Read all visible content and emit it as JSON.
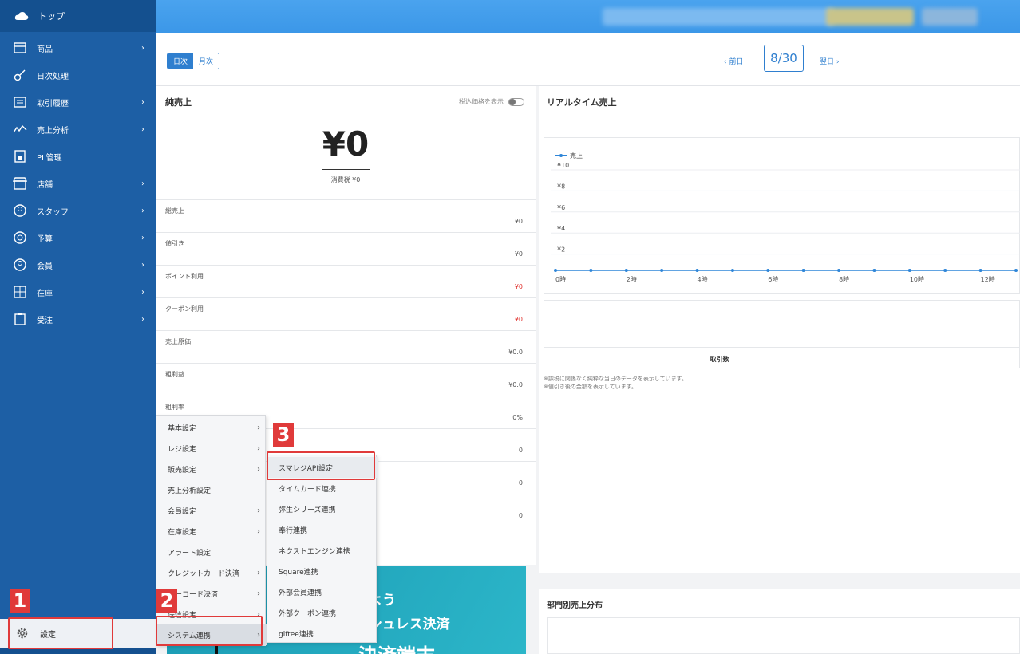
{
  "sidebar": {
    "top_label": "トップ",
    "items": [
      {
        "label": "商品",
        "icon": "box-icon",
        "chevron": "›"
      },
      {
        "label": "日次処理",
        "icon": "key-icon",
        "chevron": ""
      },
      {
        "label": "取引履歴",
        "icon": "list-icon",
        "chevron": "›"
      },
      {
        "label": "売上分析",
        "icon": "chart-icon",
        "chevron": "›"
      },
      {
        "label": "PL管理",
        "icon": "document-icon",
        "chevron": ""
      },
      {
        "label": "店舗",
        "icon": "store-icon",
        "chevron": "›"
      },
      {
        "label": "スタッフ",
        "icon": "staff-icon",
        "chevron": "›"
      },
      {
        "label": "予算",
        "icon": "target-icon",
        "chevron": "›"
      },
      {
        "label": "会員",
        "icon": "member-icon",
        "chevron": "›"
      },
      {
        "label": "在庫",
        "icon": "grid-icon",
        "chevron": "›"
      },
      {
        "label": "受注",
        "icon": "clipboard-icon",
        "chevron": "›"
      }
    ],
    "settings_label": "設定"
  },
  "datebar": {
    "daily": "日次",
    "monthly": "月次",
    "prev": "‹ 前日",
    "date": "8/30",
    "next": "翌日 ›"
  },
  "net_sales": {
    "title": "純売上",
    "tax_toggle_label": "税込価格を表示",
    "amount": "¥0",
    "tax_line": "消費税 ¥0",
    "rows": [
      {
        "label": "総売上",
        "value": "¥0"
      },
      {
        "label": "値引き",
        "value": "¥0"
      },
      {
        "label": "ポイント利用",
        "value": "¥0"
      },
      {
        "label": "クーポン利用",
        "value": "¥0"
      },
      {
        "label": "売上原価",
        "value": "¥0.0"
      },
      {
        "label": "粗利益",
        "value": "¥0.0"
      },
      {
        "label": "粗利率",
        "value": "0%"
      },
      {
        "label": "",
        "value": "0"
      },
      {
        "label": "",
        "value": "0"
      },
      {
        "label": "",
        "value": "0"
      }
    ]
  },
  "realtime": {
    "title": "リアルタイム売上",
    "transactions_label": "取引数",
    "note1": "※課税に関係なく純粋な当日のデータを表示しています。",
    "note2": "※値引き後の金額を表示しています。"
  },
  "chart_data": {
    "type": "line",
    "legend": [
      "売上"
    ],
    "y_ticks": [
      "¥10",
      "¥8",
      "¥6",
      "¥4",
      "¥2"
    ],
    "x_ticks": [
      "0時",
      "2時",
      "4時",
      "6時",
      "8時",
      "10時",
      "12時"
    ],
    "ylim": [
      0,
      10
    ],
    "series": [
      {
        "name": "売上",
        "x": [
          0,
          1,
          2,
          3,
          4,
          5,
          6,
          7,
          8,
          9,
          10,
          11,
          12,
          13
        ],
        "values": [
          0,
          0,
          0,
          0,
          0,
          0,
          0,
          0,
          0,
          0,
          0,
          0,
          0,
          0
        ]
      }
    ],
    "color": "#2f86d8"
  },
  "dept": {
    "title": "部門別売上分布"
  },
  "banner": {
    "line1": "めよう",
    "line2": "ッシュレス決済",
    "line3": "決済端末"
  },
  "menu_settings": {
    "items": [
      {
        "label": "基本設定",
        "arrow": "›"
      },
      {
        "label": "レジ設定",
        "arrow": "›"
      },
      {
        "label": "販売設定",
        "arrow": "›"
      },
      {
        "label": "売上分析設定",
        "arrow": ""
      },
      {
        "label": "会員設定",
        "arrow": "›"
      },
      {
        "label": "在庫設定",
        "arrow": "›"
      },
      {
        "label": "アラート設定",
        "arrow": ""
      },
      {
        "label": "クレジットカード決済",
        "arrow": "›"
      },
      {
        "label": "バーコード決済",
        "arrow": "›"
      },
      {
        "label": "送信設定",
        "arrow": "›"
      },
      {
        "label": "システム連携",
        "arrow": "›"
      }
    ]
  },
  "menu_system": {
    "items": [
      {
        "label": "スマレジAPI設定"
      },
      {
        "label": "タイムカード連携"
      },
      {
        "label": "弥生シリーズ連携"
      },
      {
        "label": "奉行連携"
      },
      {
        "label": "ネクストエンジン連携"
      },
      {
        "label": "Square連携"
      },
      {
        "label": "外部会員連携"
      },
      {
        "label": "外部クーポン連携"
      },
      {
        "label": "giftee連携"
      }
    ]
  },
  "annotations": {
    "step1": "1",
    "step2": "2",
    "step3": "3"
  },
  "colors": {
    "sidebar": "#1d5fa5",
    "accent": "#2f7fcf",
    "annotation": "#e03a3a",
    "negative": "#e0322e"
  }
}
